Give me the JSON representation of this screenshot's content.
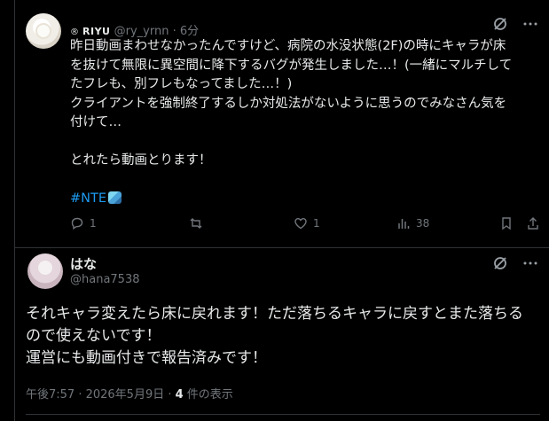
{
  "post1": {
    "display_name": "RIYU",
    "registered_mark": "®",
    "handle": "@ry_yrnn",
    "time_sep": "·",
    "time": "6分",
    "lines": [
      "昨日動画まわせなかったんですけど、病院の水没状態(2F)の時にキャラが床",
      "を抜けて無限に異空間に降下するバグが発生しました…！(一緒にマルチして",
      "たフレも、別フレもなってました…！)",
      "クライアントを強制終了するしか対処法がないように思うのでみなさん気を",
      "付けて…",
      "",
      "とれたら動画とります！",
      ""
    ],
    "hashtag": "#NTE",
    "emoji_icon": "tablet-emoji",
    "replies": "1",
    "reposts": "",
    "likes": "1",
    "views": "38"
  },
  "post2": {
    "display_name": "はな",
    "handle": "@hana7538",
    "lines": [
      "それキャラ変えたら床に戻れます！ただ落ちるキャラに戻すとまた落ちる",
      "ので使えないです！",
      "運営にも動画付きで報告済みです！"
    ],
    "timestamp": "午後7:57 · 2026年5月9日 · ",
    "view_count": "4",
    "view_label": " 件の表示"
  }
}
